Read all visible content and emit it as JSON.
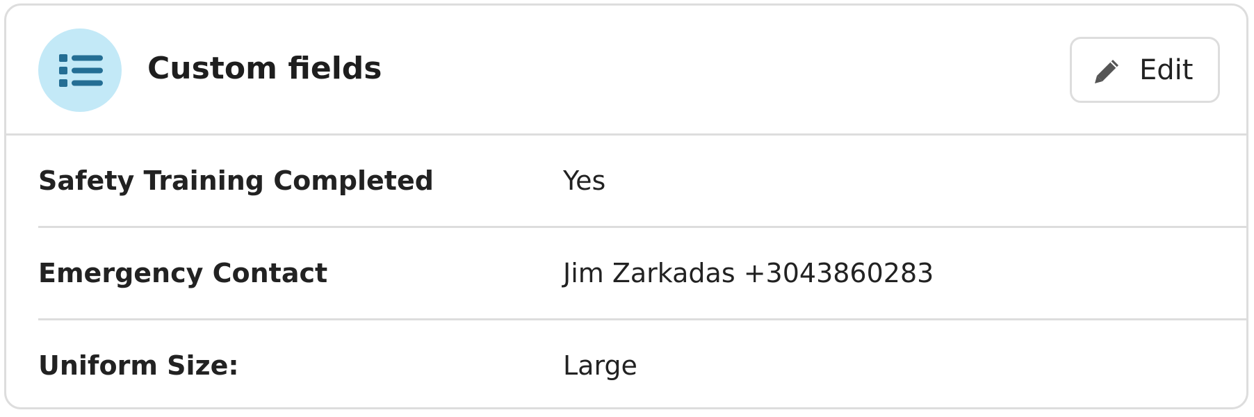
{
  "card": {
    "title": "Custom fields",
    "header_icon": "list-icon",
    "edit_button": {
      "label": "Edit",
      "icon": "pencil-icon"
    },
    "fields": [
      {
        "label": "Safety Training Completed",
        "value": "Yes"
      },
      {
        "label": "Emergency Contact",
        "value": "Jim Zarkadas +3043860283"
      },
      {
        "label": "Uniform Size:",
        "value": "Large"
      }
    ]
  },
  "colors": {
    "icon_circle_bg": "#c3e9f7",
    "icon_fg": "#246e94",
    "border": "#dddddd",
    "text": "#222222"
  }
}
